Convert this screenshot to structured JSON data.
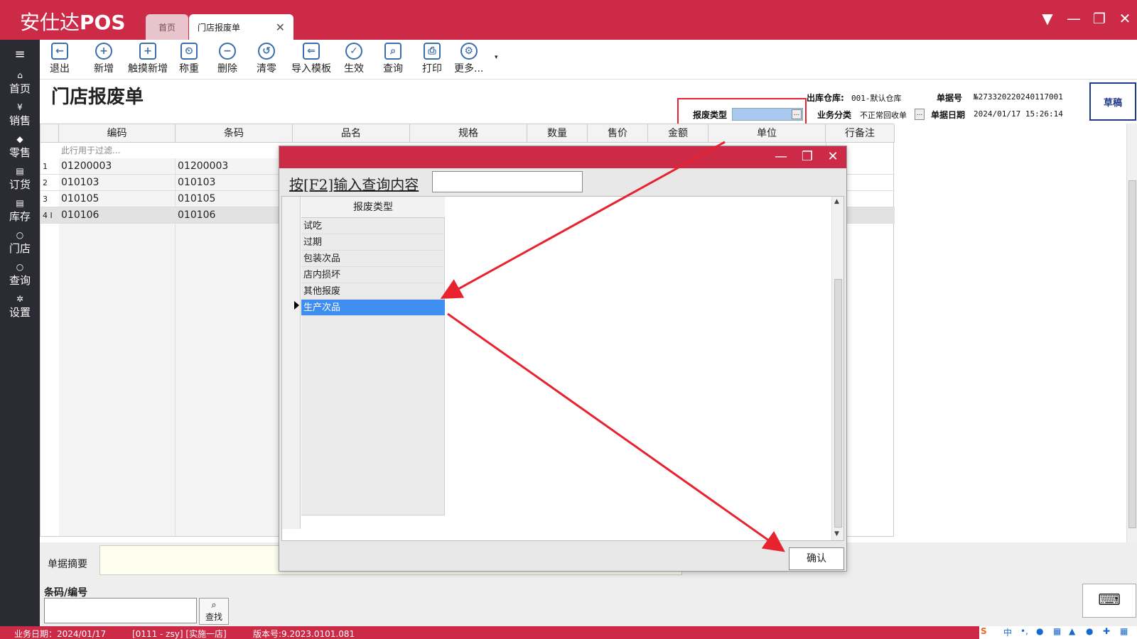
{
  "app": {
    "title_cn": "安仕达",
    "title_en": "POS"
  },
  "tabs": [
    {
      "label": "首页"
    },
    {
      "label": "门店报废单",
      "close": "✕"
    }
  ],
  "window_controls": [
    "▼",
    "—",
    "❐",
    "✕"
  ],
  "sidebar": {
    "items": [
      {
        "label": "首页",
        "icon": "home-icon"
      },
      {
        "label": "销售",
        "icon": "yuan-icon"
      },
      {
        "label": "零售",
        "icon": "tag-icon"
      },
      {
        "label": "订货",
        "icon": "box-icon"
      },
      {
        "label": "库存",
        "icon": "stack-icon"
      },
      {
        "label": "门店",
        "icon": "search-icon"
      },
      {
        "label": "查询",
        "icon": "search-icon"
      },
      {
        "label": "设置",
        "icon": "gear-icon"
      }
    ]
  },
  "toolbar": {
    "buttons": [
      {
        "label": "退出",
        "glyph": "←"
      },
      {
        "label": "新增",
        "glyph": "+"
      },
      {
        "label": "触摸新增",
        "glyph": "+"
      },
      {
        "label": "称重",
        "glyph": "⏲"
      },
      {
        "label": "删除",
        "glyph": "−"
      },
      {
        "label": "清零",
        "glyph": "↺"
      },
      {
        "label": "导入模板",
        "glyph": "⇐"
      },
      {
        "label": "生效",
        "glyph": "✓"
      },
      {
        "label": "查询",
        "glyph": "⌕"
      },
      {
        "label": "打印",
        "glyph": "⎙"
      },
      {
        "label": "更多...",
        "glyph": "⚙"
      }
    ]
  },
  "header": {
    "page_title": "门店报废单",
    "warehouse_label": "出库仓库:",
    "warehouse_value": "001-默认仓库",
    "doc_no_label": "单据号",
    "doc_no_value": "№273320220240117001",
    "scrap_type_label": "报废类型",
    "business_label": "业务分类",
    "business_value": "不正常回收单",
    "doc_date_label": "单据日期",
    "doc_date_value": "2024/01/17 15:26:14",
    "status": "草稿",
    "dots": "..."
  },
  "grid": {
    "columns": [
      "编码",
      "条码",
      "品名",
      "规格",
      "数量",
      "售价",
      "金额",
      "单位",
      "行备注"
    ],
    "filter_placeholder": "此行用于过滤...",
    "rows": [
      {
        "n": "1",
        "code": "01200003",
        "barcode": "01200003"
      },
      {
        "n": "2",
        "code": "010103",
        "barcode": "010103"
      },
      {
        "n": "3",
        "code": "010105",
        "barcode": "010105"
      },
      {
        "n": "4 I",
        "code": "010106",
        "barcode": "010106"
      }
    ]
  },
  "bottom": {
    "summary_label": "单据摘要",
    "barcode_label": "条码/编号",
    "find_label": "查找"
  },
  "statusbar": {
    "business_date": "业务日期：2024/01/17",
    "user": "[0111 - zsy]  [实施一店]",
    "version": "版本号:9.2023.0101.081"
  },
  "dialog": {
    "search_label": "按[F2]输入查询内容",
    "column": "报废类型",
    "options": [
      "试吃",
      "过期",
      "包装次品",
      "店内损坏",
      "其他报废",
      "生产次品"
    ],
    "selected_index": 5,
    "confirm_label": "确认"
  },
  "colors": {
    "brand": "#cc2a47",
    "sidebar": "#2b2b33",
    "selection": "#3d8ef0",
    "annotation": "#e8222f"
  }
}
